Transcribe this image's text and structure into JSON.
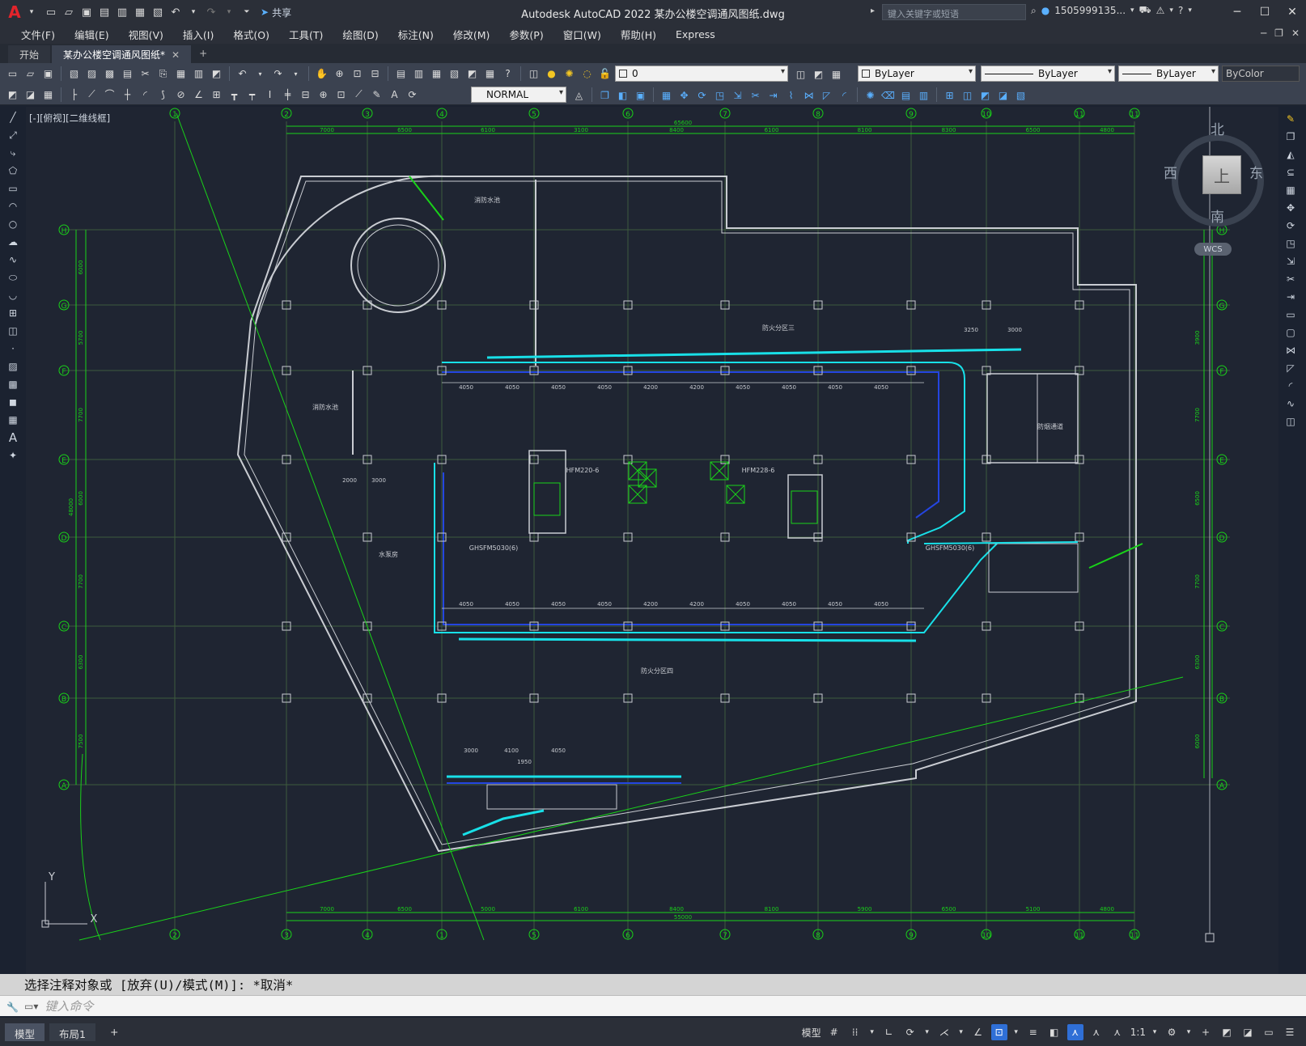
{
  "app": {
    "title": "Autodesk AutoCAD 2022    某办公楼空调通风图纸.dwg",
    "search_placeholder": "键入关键字或短语",
    "user": "1505999135...",
    "share_label": "共享",
    "logo": "A"
  },
  "menu": [
    "文件(F)",
    "编辑(E)",
    "视图(V)",
    "插入(I)",
    "格式(O)",
    "工具(T)",
    "绘图(D)",
    "标注(N)",
    "修改(M)",
    "参数(P)",
    "窗口(W)",
    "帮助(H)",
    "Express"
  ],
  "tabs": [
    {
      "label": "开始"
    },
    {
      "label": "某办公楼空调通风图纸*"
    }
  ],
  "toolbar": {
    "layer_value": "0",
    "style_value": "NORMAL",
    "color_value": "ByLayer",
    "linetype_value": "ByLayer",
    "lineweight_value": "ByLayer",
    "plotstyle_value": "ByColor"
  },
  "viewport_label": "[-][俯视][二维线框]",
  "viewcube": {
    "face": "上",
    "north": "北",
    "south": "南",
    "east": "东",
    "west": "西",
    "wcs": "WCS"
  },
  "drawing": {
    "grid_top": [
      "1",
      "2",
      "3",
      "4",
      "5",
      "6",
      "7",
      "8",
      "9",
      "10",
      "11",
      "11"
    ],
    "grid_bottom": [
      "2",
      "3",
      "4",
      "1",
      "5",
      "6",
      "7",
      "8",
      "9",
      "10",
      "11",
      "11"
    ],
    "grid_rows": [
      "H",
      "G",
      "F",
      "E",
      "D",
      "C",
      "B",
      "A"
    ],
    "dims_top": [
      "7000",
      "6500",
      "6100",
      "3100",
      "8400",
      "6100",
      "8100",
      "8300",
      "6500",
      "4800"
    ],
    "dims_top_total": "65600",
    "dims_bottom": [
      "7000",
      "6500",
      "5000",
      "6100",
      "8400",
      "8100",
      "5900",
      "6500",
      "5100",
      "4800"
    ],
    "dims_bottom_total": "55000",
    "dims_left": [
      "6000",
      "5700",
      "7700",
      "6000",
      "7700",
      "6300",
      "7500"
    ],
    "dims_left_total": "48000",
    "dims_right": [
      "3900",
      "7700",
      "6500",
      "7700",
      "6300",
      "6000"
    ],
    "duct_dims_top": [
      "4050",
      "4050",
      "4050",
      "4050",
      "4200",
      "4200",
      "4050",
      "4050",
      "4050",
      "4050"
    ],
    "duct_dims_bottom": [
      "4050",
      "4050",
      "4050",
      "4050",
      "4200",
      "4200",
      "4050",
      "4050",
      "4050",
      "4050"
    ],
    "labels": {
      "fire_pool_1": "消防水池",
      "fire_pool_2": "消防水池",
      "pump_room": "水泵房",
      "fire_zone_3": "防火分区三",
      "fire_zone_2": "防火分区四",
      "fire_passage": "防烟通道",
      "equip_1": "HFM220-6",
      "equip_2": "HFM228-6",
      "equip_3": "GHSFM5030(6)",
      "equip_4": "GHSFM5030(6)",
      "dims_3250": "3250",
      "dims_3000": "3000",
      "dims_2000": "2000",
      "dims_3000b": "3000",
      "dims_1950": "1950",
      "dims_4100": "4100",
      "dims_4050": "4050",
      "dims_3000c": "3000"
    }
  },
  "command": {
    "history": "选择注释对象或 [放弃(U)/模式(M)]: *取消*",
    "input_placeholder": "键入命令"
  },
  "status": {
    "model_tab": "模型",
    "layout_tab": "布局1",
    "model_label": "模型",
    "scale": "1:1"
  }
}
